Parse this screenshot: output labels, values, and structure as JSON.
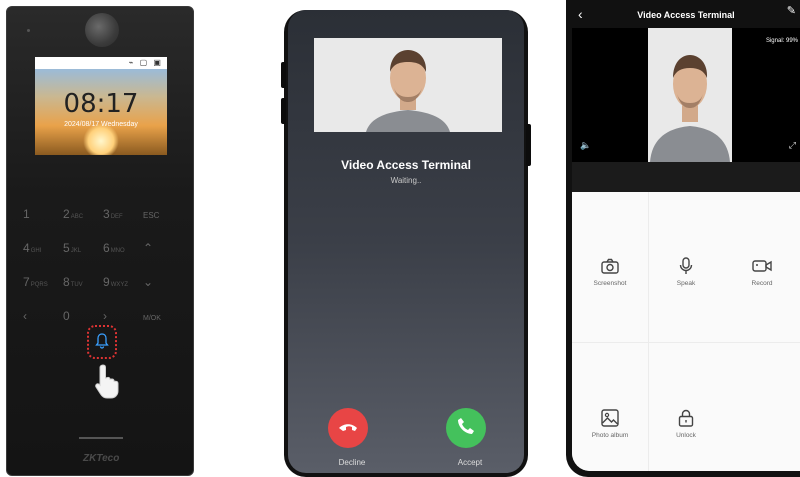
{
  "terminal": {
    "clock": "08:17",
    "date": "2024/08/17 Wednesday",
    "status_icons": "⌁ ▢ ▣",
    "keys": [
      [
        {
          "main": "1",
          "sub": ""
        },
        {
          "main": "2",
          "sub": "ABC"
        },
        {
          "main": "3",
          "sub": "DEF"
        },
        {
          "main": "ESC",
          "sub": ""
        }
      ],
      [
        {
          "main": "4",
          "sub": "GHI"
        },
        {
          "main": "5",
          "sub": "JKL"
        },
        {
          "main": "6",
          "sub": "MNO"
        },
        {
          "main": "⌃",
          "sub": ""
        }
      ],
      [
        {
          "main": "7",
          "sub": "PQRS"
        },
        {
          "main": "8",
          "sub": "TUV"
        },
        {
          "main": "9",
          "sub": "WXYZ"
        },
        {
          "main": "⌄",
          "sub": ""
        }
      ],
      [
        {
          "main": "‹",
          "sub": ""
        },
        {
          "main": "0",
          "sub": ""
        },
        {
          "main": "›",
          "sub": ""
        },
        {
          "main": "M/OK",
          "sub": ""
        }
      ]
    ],
    "brand": "ZKTeco"
  },
  "call": {
    "title": "Video Access Terminal",
    "status": "Waiting..",
    "decline_label": "Decline",
    "accept_label": "Accept",
    "decline_color": "#e84545",
    "accept_color": "#44c15c"
  },
  "app": {
    "title": "Video Access Terminal",
    "signal": "Signal: 99%",
    "actions": [
      {
        "label": "Screenshot",
        "icon": "camera-icon"
      },
      {
        "label": "Speak",
        "icon": "microphone-icon"
      },
      {
        "label": "Record",
        "icon": "video-camera-icon"
      },
      {
        "label": "Photo album",
        "icon": "image-icon"
      },
      {
        "label": "Unlock",
        "icon": "lock-icon"
      }
    ]
  }
}
